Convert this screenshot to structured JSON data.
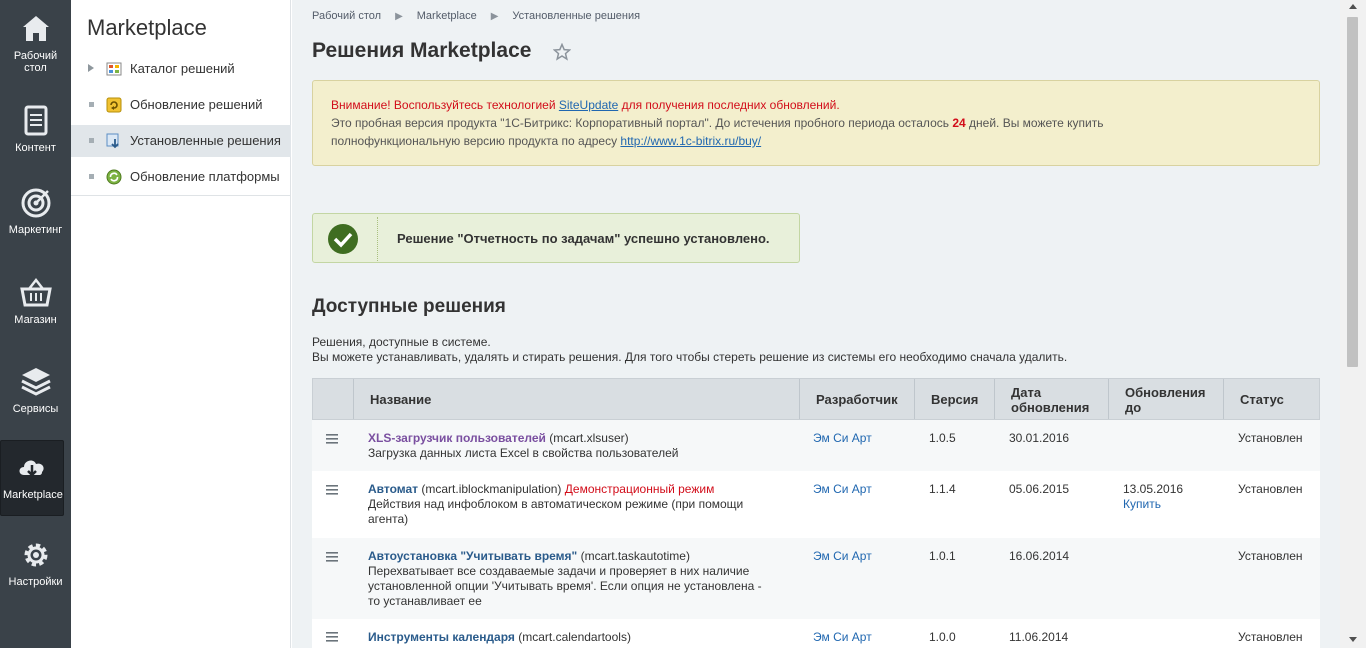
{
  "iconbar": {
    "items": [
      {
        "label": "Рабочий стол",
        "icon": "home-icon"
      },
      {
        "label": "Контент",
        "icon": "document-icon"
      },
      {
        "label": "Маркетинг",
        "icon": "target-icon"
      },
      {
        "label": "Магазин",
        "icon": "basket-icon"
      },
      {
        "label": "Сервисы",
        "icon": "layers-icon"
      },
      {
        "label": "Marketplace",
        "icon": "cloud-download-icon"
      },
      {
        "label": "Настройки",
        "icon": "gear-icon"
      }
    ]
  },
  "submenu": {
    "title": "Marketplace",
    "items": [
      {
        "label": "Каталог решений"
      },
      {
        "label": "Обновление решений"
      },
      {
        "label": "Установленные решения"
      },
      {
        "label": "Обновление платформы"
      }
    ]
  },
  "breadcrumb": [
    "Рабочий стол",
    "Marketplace",
    "Установленные решения"
  ],
  "page": {
    "title": "Решения Marketplace"
  },
  "notice": {
    "line1_prefix": "Внимание! Воспользуйтесь технологией ",
    "line1_link": "SiteUpdate",
    "line1_suffix": " для получения последних обновлений.",
    "line2_prefix": "Это пробная версия продукта \"1С-Битрикс: Корпоративный портал\". До истечения пробного периода осталось ",
    "days": "24",
    "line2_suffix": " дней. Вы можете купить",
    "line3_prefix": "полнофункциональную версию продукта по адресу ",
    "line3_link": "http://www.1c-bitrix.ru/buy/"
  },
  "success": {
    "message": "Решение \"Отчетность по задачам\" успешно установлено."
  },
  "section": {
    "title": "Доступные решения",
    "desc1": "Решения, доступные в системе.",
    "desc2": "Вы можете устанавливать, удалять и стирать решения. Для того чтобы стереть решение из системы его необходимо сначала удалить."
  },
  "table": {
    "headers": {
      "name": "Название",
      "developer": "Разработчик",
      "version": "Версия",
      "date_line1": "Дата",
      "date_line2": "обновления",
      "updates_line1": "Обновления",
      "updates_line2": "до",
      "status": "Статус"
    },
    "rows": [
      {
        "title": "XLS-загрузчик пользователей",
        "code": " (mcart.xlsuser)",
        "demo": "",
        "desc": [
          "Загрузка данных листа Excel в свойства пользователей"
        ],
        "developer": "Эм Си Арт",
        "version": "1.0.5",
        "date": "30.01.2016",
        "updates_until": "",
        "buy": "",
        "status": "Установлен"
      },
      {
        "title": "Автомат",
        "code": " (mcart.iblockmanipulation) ",
        "demo": "Демонстрационный режим",
        "desc": [
          "Действия над инфоблоком в автоматическом режиме (при помощи",
          "агента)"
        ],
        "developer": "Эм Си Арт",
        "version": "1.1.4",
        "date": "05.06.2015",
        "updates_until": "13.05.2016",
        "buy": "Купить",
        "status": "Установлен"
      },
      {
        "title": "Автоустановка \"Учитывать время\"",
        "code": " (mcart.taskautotime)",
        "demo": "",
        "desc": [
          "Перехватывает все создаваемые задачи и проверяет в них наличие",
          "установленной опции 'Учитывать время'. Если опция не установлена -",
          "то устанавливает ее"
        ],
        "developer": "Эм Си Арт",
        "version": "1.0.1",
        "date": "16.06.2014",
        "updates_until": "",
        "buy": "",
        "status": "Установлен"
      },
      {
        "title": "Инструменты календаря",
        "code": " (mcart.calendartools)",
        "demo": "",
        "desc": [],
        "developer": "Эм Си Арт",
        "version": "1.0.0",
        "date": "11.06.2014",
        "updates_until": "",
        "buy": "",
        "status": "Установлен"
      }
    ]
  },
  "colors": {
    "iconbar_bg": "#3a4249",
    "main_bg": "#eef2f4",
    "warning_red": "#d20d1a",
    "link_blue": "#2067b0",
    "success_bg": "#e8f0da"
  }
}
